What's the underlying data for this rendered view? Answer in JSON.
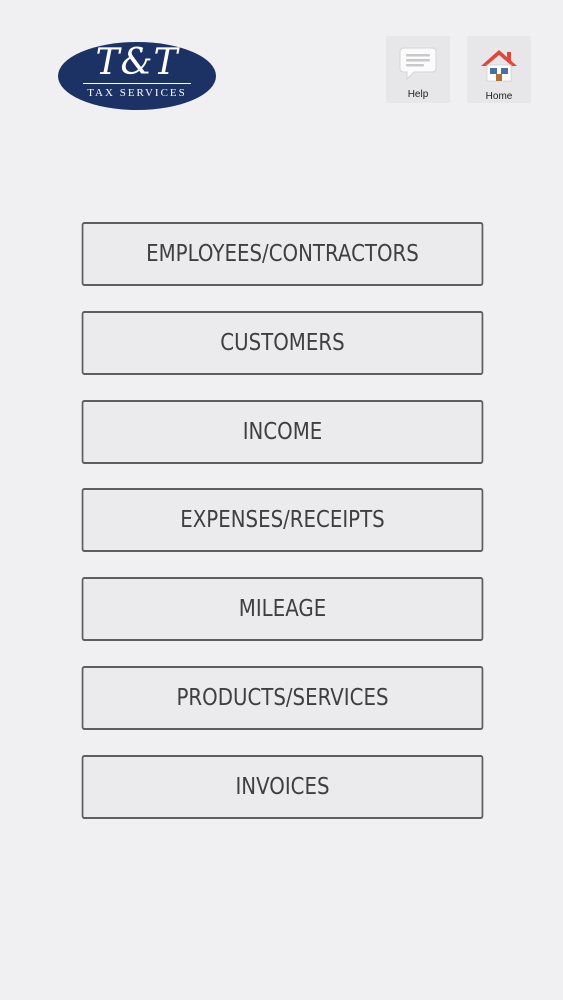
{
  "logo": {
    "letters": "T&T",
    "subtitle": "TAX SERVICES",
    "color": "#1c3164"
  },
  "toolbar": {
    "help_label": "Help",
    "home_label": "Home"
  },
  "menu": {
    "items": [
      {
        "label": "EMPLOYEES/CONTRACTORS"
      },
      {
        "label": "CUSTOMERS"
      },
      {
        "label": "INCOME"
      },
      {
        "label": "EXPENSES/RECEIPTS"
      },
      {
        "label": "MILEAGE"
      },
      {
        "label": "PRODUCTS/SERVICES"
      },
      {
        "label": "INVOICES"
      }
    ]
  },
  "colors": {
    "background": "#f0eff1",
    "button_border": "#5e5e62",
    "home_roof": "#e0473b"
  }
}
